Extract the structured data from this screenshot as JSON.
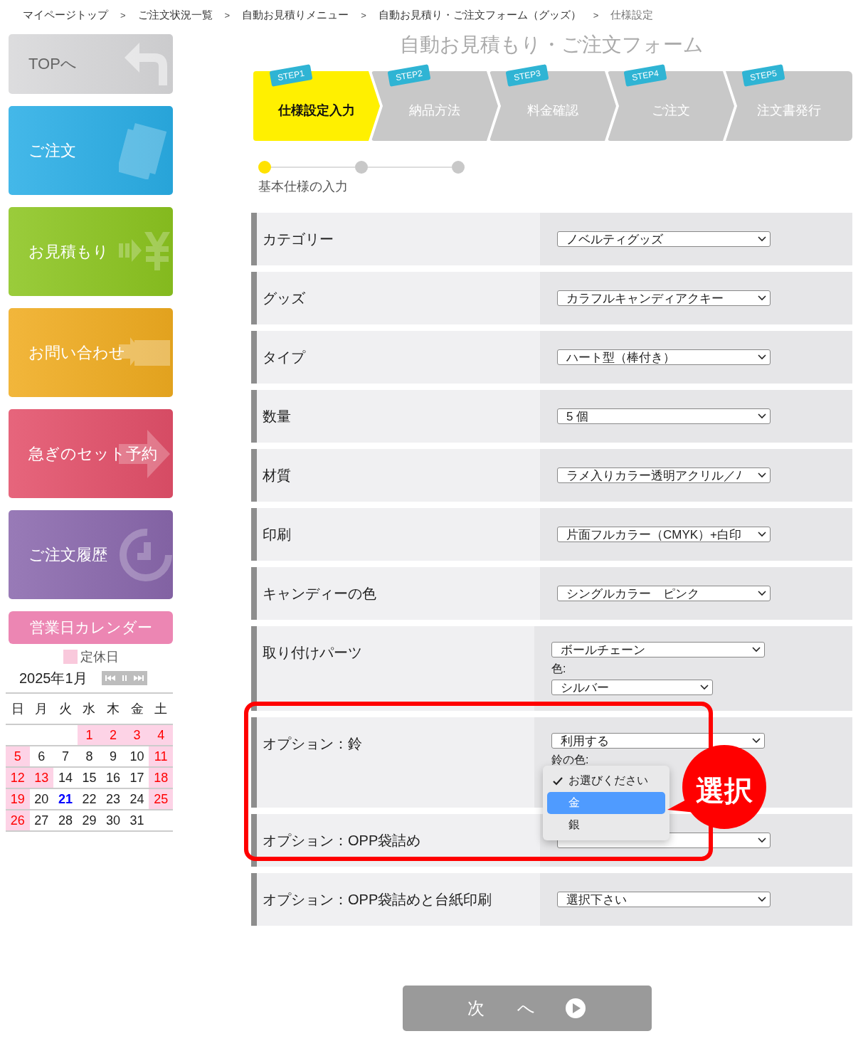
{
  "breadcrumb": [
    {
      "label": "マイページトップ",
      "current": false,
      "separator": ">"
    },
    {
      "label": "ご注文状況一覧",
      "current": false,
      "separator": ">"
    },
    {
      "label": "自動お見積りメニュー",
      "current": false,
      "separator": ">"
    },
    {
      "label": "自動お見積り・ご注文フォーム（グッズ）",
      "current": false,
      "separator": ">"
    },
    {
      "label": "仕様設定",
      "current": true
    }
  ],
  "sidebar": {
    "nav": [
      {
        "label": "TOPへ",
        "color": "#d8d8da"
      },
      {
        "label": "ご注文",
        "color": "#2aaee6"
      },
      {
        "label": "お見積もり",
        "color": "#8cc520"
      },
      {
        "label": "お問い合わせ",
        "color": "#f0ac20"
      },
      {
        "label": "急ぎのセット予約",
        "color": "#e3506a"
      },
      {
        "label": "ご注文履歴",
        "color": "#8a68ad"
      }
    ],
    "calendar": {
      "button": "営業日カレンダー",
      "legend": "定休日",
      "month": "2025年1月",
      "weekdays": [
        "日",
        "月",
        "火",
        "水",
        "木",
        "金",
        "土"
      ],
      "weeks": [
        [
          {
            "holiday": false
          },
          {
            "holiday": false
          },
          {
            "holiday": false
          },
          {
            "day": "1",
            "holiday": true,
            "today": false
          },
          {
            "day": "2",
            "holiday": true,
            "today": false
          },
          {
            "day": "3",
            "holiday": true,
            "today": false
          },
          {
            "day": "4",
            "holiday": true,
            "today": false
          }
        ],
        [
          {
            "day": "5",
            "holiday": true,
            "today": false
          },
          {
            "day": "6",
            "holiday": false,
            "today": false
          },
          {
            "day": "7",
            "holiday": false,
            "today": false
          },
          {
            "day": "8",
            "holiday": false,
            "today": false
          },
          {
            "day": "9",
            "holiday": false,
            "today": false
          },
          {
            "day": "10",
            "holiday": false,
            "today": false
          },
          {
            "day": "11",
            "holiday": true,
            "today": false
          }
        ],
        [
          {
            "day": "12",
            "holiday": true,
            "today": false
          },
          {
            "day": "13",
            "holiday": true,
            "today": false
          },
          {
            "day": "14",
            "holiday": false,
            "today": false
          },
          {
            "day": "15",
            "holiday": false,
            "today": false
          },
          {
            "day": "16",
            "holiday": false,
            "today": false
          },
          {
            "day": "17",
            "holiday": false,
            "today": false
          },
          {
            "day": "18",
            "holiday": true,
            "today": false
          }
        ],
        [
          {
            "day": "19",
            "holiday": true,
            "today": false
          },
          {
            "day": "20",
            "holiday": false,
            "today": false
          },
          {
            "day": "21",
            "holiday": false,
            "today": true
          },
          {
            "day": "22",
            "holiday": false,
            "today": false
          },
          {
            "day": "23",
            "holiday": false,
            "today": false
          },
          {
            "day": "24",
            "holiday": false,
            "today": false
          },
          {
            "day": "25",
            "holiday": true,
            "today": false
          }
        ],
        [
          {
            "day": "26",
            "holiday": true,
            "today": false
          },
          {
            "day": "27",
            "holiday": false,
            "today": false
          },
          {
            "day": "28",
            "holiday": false,
            "today": false
          },
          {
            "day": "29",
            "holiday": false,
            "today": false
          },
          {
            "day": "30",
            "holiday": false,
            "today": false
          },
          {
            "day": "31",
            "holiday": false,
            "today": false
          },
          {
            "holiday": false
          }
        ]
      ]
    }
  },
  "form": {
    "title": "自動お見積もり・ご注文フォーム",
    "steps": [
      {
        "badge": "STEP1",
        "label": "仕様設定入力",
        "selected": true
      },
      {
        "badge": "STEP2",
        "label": "納品方法",
        "selected": false
      },
      {
        "badge": "STEP3",
        "label": "料金確認",
        "selected": false
      },
      {
        "badge": "STEP4",
        "label": "ご注文",
        "selected": false
      },
      {
        "badge": "STEP5",
        "label": "注文書発行",
        "selected": false
      }
    ],
    "progress": {
      "dots": [
        {
          "selected": true
        },
        {
          "selected": false
        },
        {
          "selected": false
        }
      ],
      "label": "基本仕様の入力"
    },
    "rows": [
      {
        "label": "カテゴリー",
        "fields": [
          {
            "kind": "select",
            "value": "ノベルティグッズ"
          }
        ]
      },
      {
        "label": "グッズ",
        "fields": [
          {
            "kind": "select",
            "value": "カラフルキャンディアクキー"
          }
        ]
      },
      {
        "label": "タイプ",
        "fields": [
          {
            "kind": "select",
            "value": "ハート型（棒付き）"
          }
        ]
      },
      {
        "label": "数量",
        "fields": [
          {
            "kind": "select",
            "value": "5 個"
          }
        ]
      },
      {
        "label": "材質",
        "fields": [
          {
            "kind": "select",
            "value": "ラメ入りカラー透明アクリル／ﾉ"
          }
        ]
      },
      {
        "label": "印刷",
        "fields": [
          {
            "kind": "select",
            "value": "片面フルカラー（CMYK）+白印"
          }
        ]
      },
      {
        "label": "キャンディーの色",
        "fields": [
          {
            "kind": "select",
            "value": "シングルカラー　ピンク"
          }
        ]
      },
      {
        "label": "取り付けパーツ",
        "fields": [
          {
            "kind": "select",
            "value": "ボールチェーン"
          },
          {
            "kind": "label",
            "text": "色:"
          },
          {
            "kind": "select_short",
            "value": "シルバー"
          }
        ]
      },
      {
        "label": "オプション：鈴",
        "fields": [
          {
            "kind": "select",
            "value": "利用する"
          },
          {
            "kind": "label",
            "text": "鈴の色:"
          },
          {
            "kind": "popup",
            "options": [
              {
                "label": "お選びください",
                "checked": true,
                "selected": false
              },
              {
                "label": "金",
                "checked": false,
                "selected": true
              },
              {
                "label": "銀",
                "checked": false,
                "selected": false
              }
            ]
          }
        ],
        "callout": "選択"
      },
      {
        "label": "オプション：OPP袋詰め",
        "fields": [
          {
            "kind": "select"
          }
        ]
      },
      {
        "label": "オプション：OPP袋詰めと台紙印刷",
        "fields": [
          {
            "kind": "select",
            "value": "選択下さい"
          }
        ]
      }
    ],
    "next_button": "次 へ"
  }
}
